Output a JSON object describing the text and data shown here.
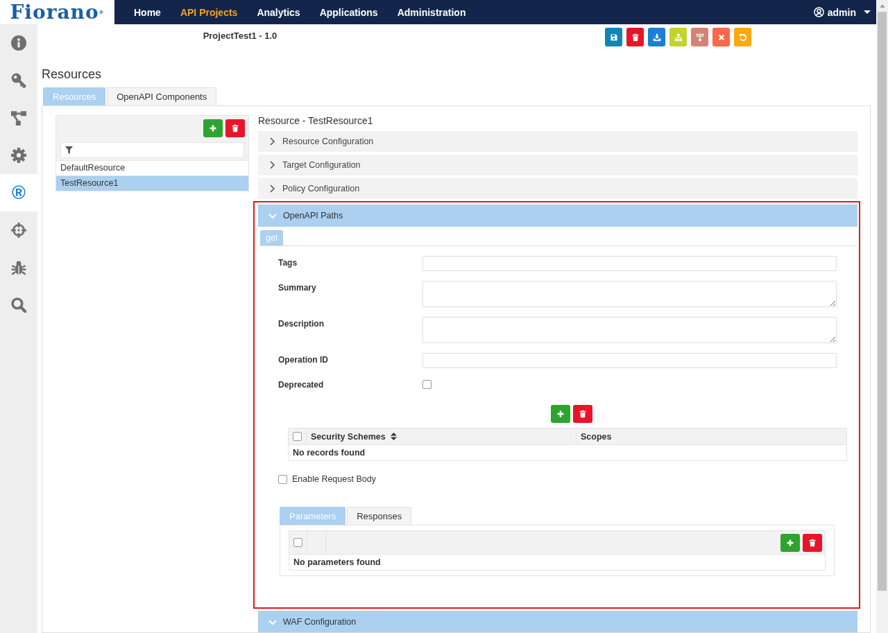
{
  "logo": {
    "text": "Fiorano$^{®}$"
  },
  "nav": [
    {
      "label": "Home",
      "selected": false
    },
    {
      "label": "API Projects",
      "selected": true
    },
    {
      "label": "Analytics",
      "selected": false
    },
    {
      "label": "Applications",
      "selected": false
    },
    {
      "label": "Administration",
      "selected": false
    }
  ],
  "user": {
    "name": "admin"
  },
  "sidebar": {
    "items": [
      {
        "kind": "info",
        "selected": false
      },
      {
        "kind": "key",
        "selected": false
      },
      {
        "kind": "flow",
        "selected": false
      },
      {
        "kind": "gear",
        "selected": false
      },
      {
        "kind": "glyph",
        "glyph": "®",
        "selected": true
      },
      {
        "kind": "crosshair",
        "selected": false
      },
      {
        "kind": "bug",
        "selected": false
      },
      {
        "kind": "search",
        "selected": false
      }
    ]
  },
  "project": {
    "title": "ProjectTest1 - 1.0"
  },
  "toolbar": {
    "buttons": [
      {
        "kind": "save",
        "color": "#0f86b6"
      },
      {
        "kind": "trash",
        "color": "#e8152a"
      },
      {
        "kind": "download",
        "color": "#1a7fd6"
      },
      {
        "kind": "sitemap",
        "color": "#c3d42a"
      },
      {
        "kind": "tree",
        "color": "#d58175"
      },
      {
        "kind": "close",
        "color": "#fc6748"
      },
      {
        "kind": "undo",
        "color": "#fba90b"
      }
    ]
  },
  "page_title": "Resources",
  "tabs": [
    {
      "label": "Resources",
      "selected": true
    },
    {
      "label": "OpenAPI Components",
      "selected": false
    }
  ],
  "resource_list": {
    "items": [
      {
        "label": "DefaultResource",
        "selected": false
      },
      {
        "label": "TestResource1",
        "selected": true
      }
    ]
  },
  "detail": {
    "title": "Resource - TestResource1",
    "sections": [
      {
        "label": "Resource Configuration",
        "expanded": false,
        "highlighted": false
      },
      {
        "label": "Target Configuration",
        "expanded": false,
        "highlighted": false
      },
      {
        "label": "Policy Configuration",
        "expanded": false,
        "highlighted": false
      },
      {
        "label": "OpenAPI Paths",
        "expanded": true,
        "highlighted": true,
        "operation": {
          "tabs": [
            {
              "label": "get",
              "selected": true
            }
          ],
          "fields": [
            {
              "label": "Tags",
              "kind": "text"
            },
            {
              "label": "Summary",
              "kind": "textarea"
            },
            {
              "label": "Description",
              "kind": "textarea"
            },
            {
              "label": "Operation ID",
              "kind": "text"
            },
            {
              "label": "Deprecated",
              "kind": "checkbox",
              "checked": false
            }
          ],
          "security_table": {
            "select_all_checked": false,
            "columns": [
              "Security Schemes",
              "Scopes"
            ],
            "empty_text": "No records found"
          },
          "request_body": {
            "label": "Enable Request Body",
            "checked": false
          },
          "sub_tabs": [
            {
              "label": "Parameters",
              "selected": true
            },
            {
              "label": "Responses",
              "selected": false
            }
          ],
          "parameters": {
            "select_all_checked": false,
            "empty_text": "No parameters found"
          }
        }
      },
      {
        "label": "WAF Configuration",
        "expanded": true,
        "highlighted": false
      }
    ]
  }
}
